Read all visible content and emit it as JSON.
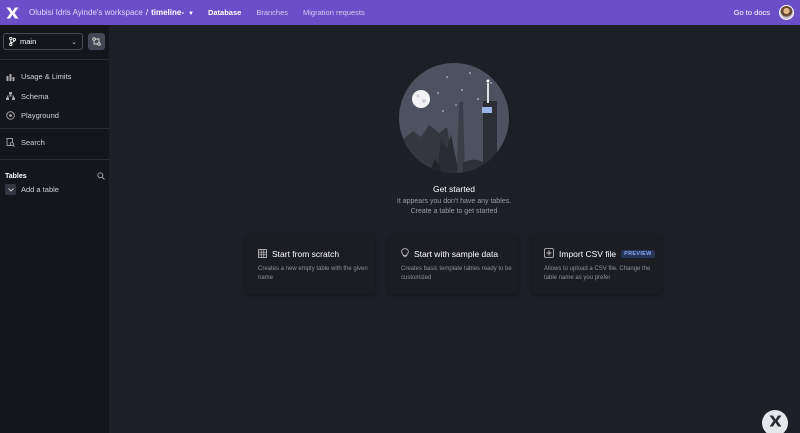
{
  "topbar": {
    "workspace": "Olubisi Idris Ayinde's workspace",
    "separator": "/",
    "database": "timeline-",
    "nav": [
      "Database",
      "Branches",
      "Migration requests"
    ],
    "docs_label": "Go to docs"
  },
  "sidebar": {
    "branch": "main",
    "menu": [
      {
        "label": "Usage & Limits",
        "icon": "chart-icon"
      },
      {
        "label": "Schema",
        "icon": "schema-icon"
      },
      {
        "label": "Playground",
        "icon": "playground-icon"
      }
    ],
    "search_label": "Search",
    "tables_label": "Tables",
    "add_table_label": "Add a table"
  },
  "main": {
    "title": "Get started",
    "subtitle_line1": "It appears you don't have any tables.",
    "subtitle_line2": "Create a table to get started",
    "cards": [
      {
        "title": "Start from scratch",
        "desc": "Creates a new empty table with the given name",
        "icon": "grid-icon"
      },
      {
        "title": "Start with sample data",
        "desc": "Creates basic template tables ready to be customized",
        "icon": "bulb-icon"
      },
      {
        "title": "Import CSV file",
        "badge": "PREVIEW",
        "desc": "Allows to upload a CSV file. Change the table name as you prefer",
        "icon": "import-icon"
      }
    ]
  },
  "colors": {
    "topbar": "#6b4fc8",
    "sidebar": "#15161b",
    "main": "#1d1f26",
    "card": "#1c1d23"
  }
}
